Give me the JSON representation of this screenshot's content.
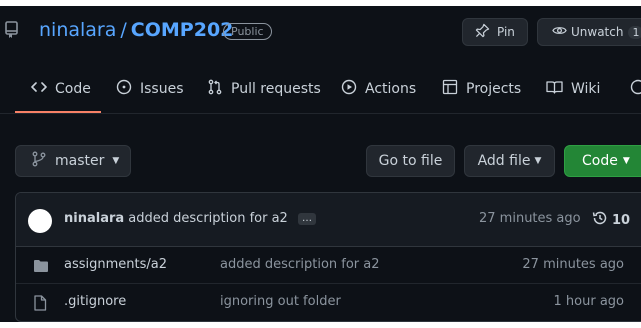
{
  "repo": {
    "owner": "ninalara",
    "separator": "/",
    "name": "COMP202",
    "visibility": "Public",
    "pin_label": "Pin",
    "unwatch_label": "Unwatch",
    "watch_count": "1"
  },
  "nav": {
    "tabs": [
      {
        "label": "Code",
        "icon": "code-icon",
        "active": true
      },
      {
        "label": "Issues",
        "icon": "issue-icon"
      },
      {
        "label": "Pull requests",
        "icon": "pull-request-icon"
      },
      {
        "label": "Actions",
        "icon": "play-icon"
      },
      {
        "label": "Projects",
        "icon": "table-icon"
      },
      {
        "label": "Wiki",
        "icon": "book-icon"
      }
    ]
  },
  "toolbar": {
    "branch": "master",
    "goto_file": "Go to file",
    "add_file": "Add file",
    "code": "Code"
  },
  "commit": {
    "author": "ninalara",
    "message": "added description for a2",
    "ellipsis": "…",
    "time": "27 minutes ago",
    "history_count": "10"
  },
  "files": [
    {
      "name": "assignments/a2",
      "type": "folder",
      "message": "added description for a2",
      "time": "27 minutes ago"
    },
    {
      "name": ".gitignore",
      "type": "file",
      "message": "ignoring out folder",
      "time": "1 hour ago"
    }
  ],
  "colors": {
    "background": "#0d1117",
    "link": "#58a6ff",
    "code_button": "#238636",
    "active_tab": "#f78166"
  }
}
